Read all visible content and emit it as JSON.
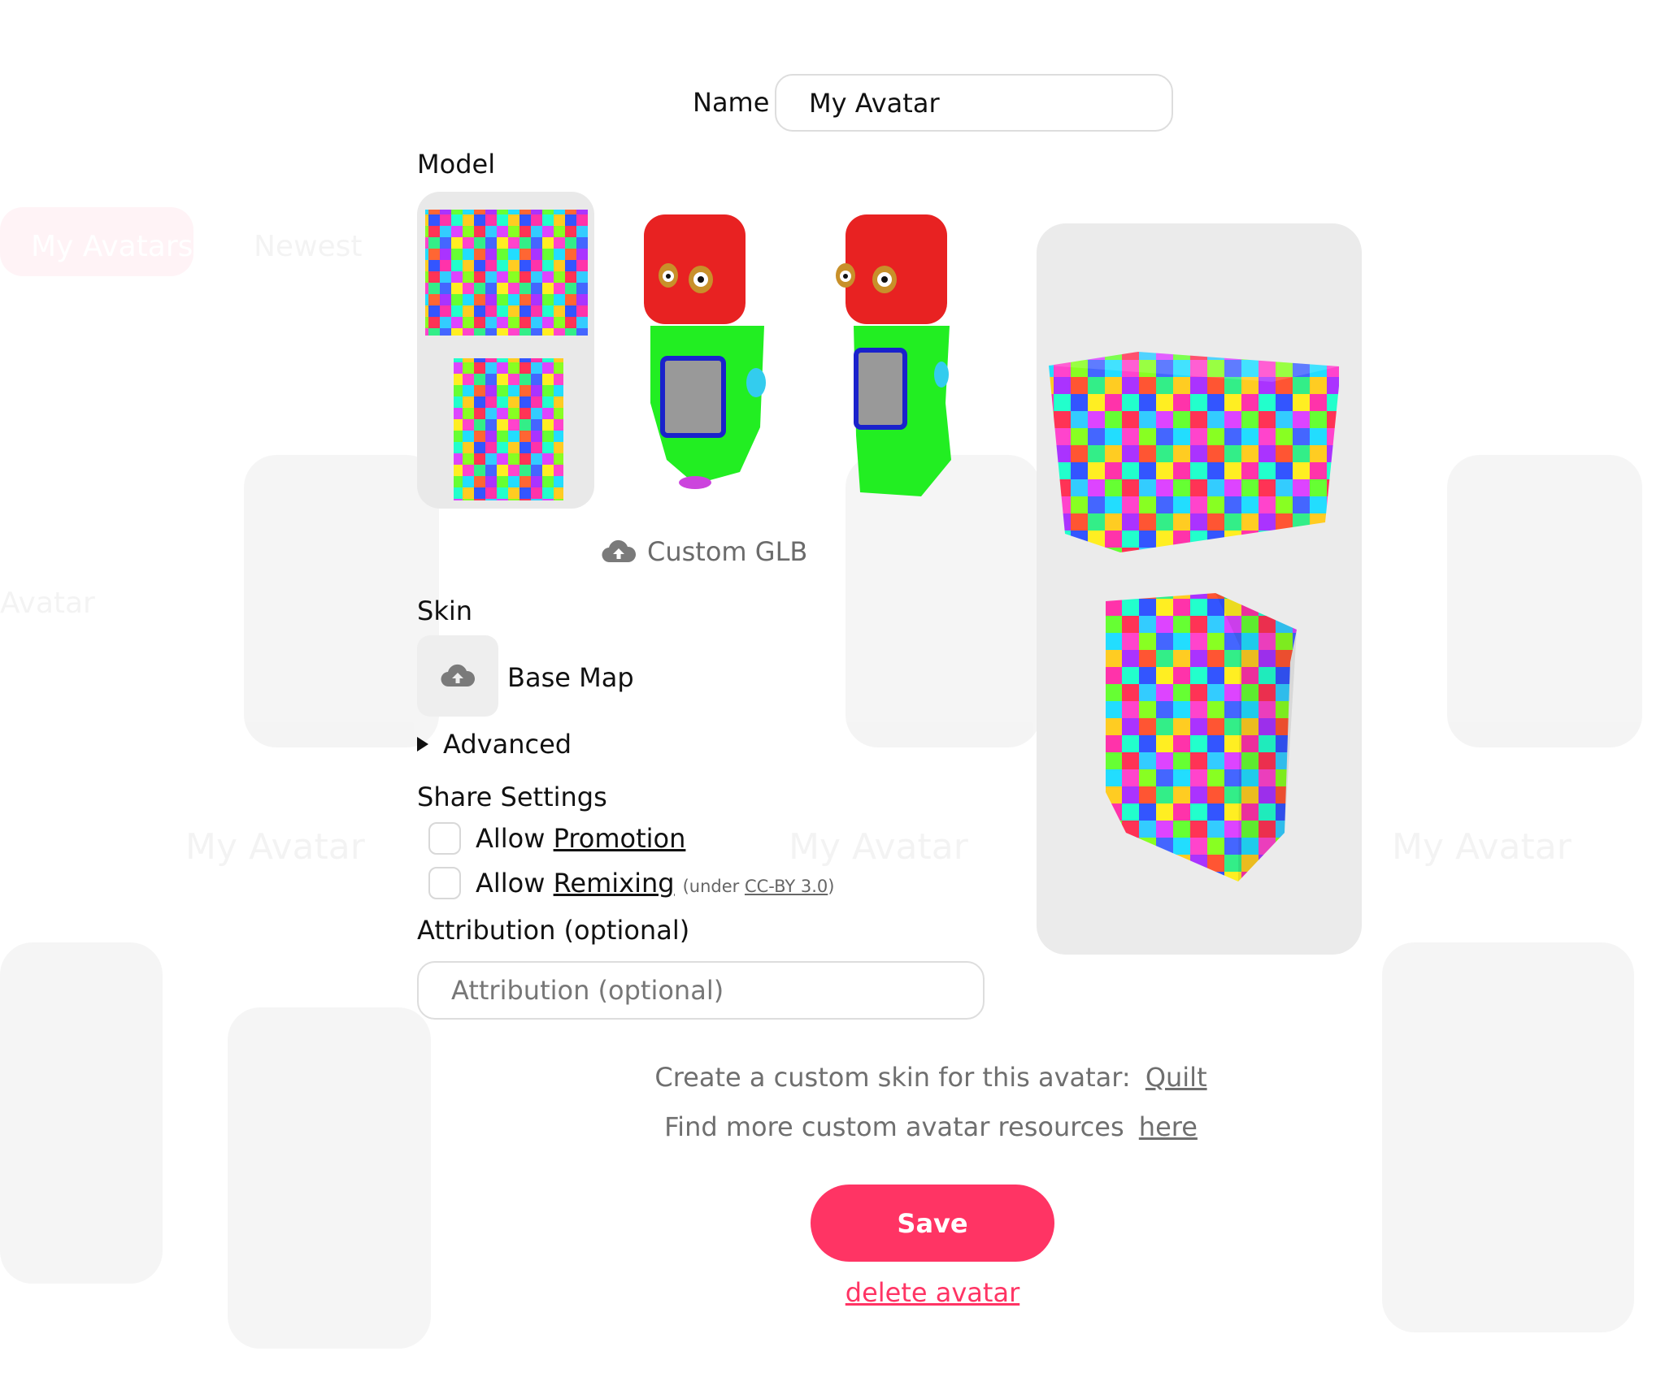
{
  "background": {
    "tabs": [
      "My Avatars",
      "Newest"
    ],
    "card_titles": [
      "My Avatar",
      "My Avatar",
      "My Avatar"
    ],
    "new_avatar_label": "Avatar"
  },
  "form": {
    "name_label": "Name",
    "name_value": "My Avatar",
    "model_label": "Model",
    "model_options": [
      {
        "name": "quilt-cubes",
        "selected": true
      },
      {
        "name": "red-head-robot-front",
        "selected": false
      },
      {
        "name": "red-head-robot-side",
        "selected": false
      }
    ],
    "custom_glb_label": "Custom GLB",
    "skin_label": "Skin",
    "base_map_label": "Base Map",
    "advanced_label": "Advanced",
    "share_settings_label": "Share Settings",
    "allow_promotion_prefix": "Allow",
    "allow_promotion_link": "Promotion",
    "allow_remixing_prefix": "Allow",
    "allow_remixing_link": "Remixing",
    "license_prefix": "(under",
    "license_link": "CC-BY 3.0",
    "license_suffix": ")",
    "attribution_label": "Attribution (optional)",
    "attribution_placeholder": "Attribution (optional)"
  },
  "info": {
    "custom_skin_text": "Create a custom skin for this avatar:",
    "custom_skin_link": "Quilt",
    "resources_text": "Find more custom avatar resources",
    "resources_link": "here"
  },
  "actions": {
    "save_label": "Save",
    "delete_label": "delete avatar"
  },
  "icons": [
    "upload-cloud-icon",
    "disclosure-triangle-icon"
  ],
  "colors": {
    "accent": "#ff3464",
    "panel_bg": "#ebebeb",
    "input_border": "#dddddd",
    "muted_text": "#6f6f6f"
  }
}
